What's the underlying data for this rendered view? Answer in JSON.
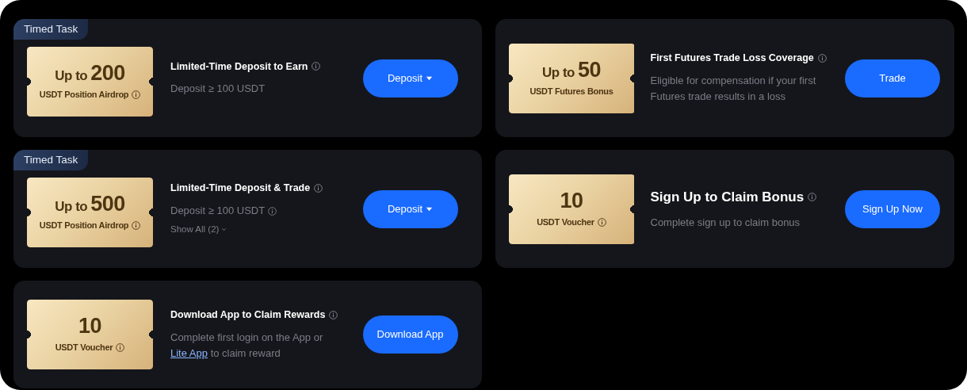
{
  "columns": [
    {
      "tasks": [
        {
          "kind": "regular",
          "timed_label": "Timed Task",
          "ticket": {
            "prefix": "Up to",
            "amount": "200",
            "subtitle": "USDT Position Airdrop",
            "subtitle_info": true
          },
          "title": "Limited-Time Deposit to Earn",
          "title_info": true,
          "description": [
            {
              "kind": "text",
              "text": "Deposit ≥ 100 USDT"
            }
          ],
          "description_info": false,
          "button": {
            "label": "Deposit",
            "dropdown": true
          }
        },
        {
          "kind": "regular",
          "timed_label": "Timed Task",
          "ticket": {
            "prefix": "Up to",
            "amount": "500",
            "subtitle": "USDT Position Airdrop",
            "subtitle_info": true
          },
          "title": "Limited-Time Deposit & Trade",
          "title_info": true,
          "description": [
            {
              "kind": "text",
              "text": "Deposit ≥ 100 USDT"
            }
          ],
          "description_info": true,
          "show_all": "Show All (2)",
          "button": {
            "label": "Deposit",
            "dropdown": true
          }
        },
        {
          "kind": "regular",
          "ticket": {
            "amount": "10",
            "subtitle": "USDT Voucher",
            "subtitle_info": true
          },
          "title": "Download App to Claim Rewards",
          "title_info": true,
          "description": [
            {
              "kind": "text",
              "text": "Complete first login on the App or"
            },
            {
              "kind": "link",
              "text": "Lite App"
            },
            {
              "kind": "text",
              "text": "to claim reward"
            }
          ],
          "description_info": false,
          "button": {
            "label": "Download App",
            "dropdown": false
          }
        }
      ]
    },
    {
      "tasks": [
        {
          "kind": "regular",
          "ticket": {
            "prefix": "Up to",
            "amount": "50",
            "subtitle": "USDT Futures Bonus",
            "subtitle_info": false
          },
          "title": "First Futures Trade Loss Coverage",
          "title_info": true,
          "description": [
            {
              "kind": "text",
              "text": "Eligible for compensation if your first Futures trade results in a loss"
            }
          ],
          "description_info": false,
          "button": {
            "label": "Trade",
            "dropdown": false
          }
        },
        {
          "kind": "featured",
          "ticket": {
            "amount": "10",
            "subtitle": "USDT Voucher",
            "subtitle_info": true
          },
          "title": "Sign Up to Claim Bonus",
          "title_info": true,
          "description": [
            {
              "kind": "text",
              "text": "Complete sign up to claim bonus"
            }
          ],
          "description_info": false,
          "button": {
            "label": "Sign Up Now",
            "dropdown": false
          }
        }
      ]
    }
  ]
}
